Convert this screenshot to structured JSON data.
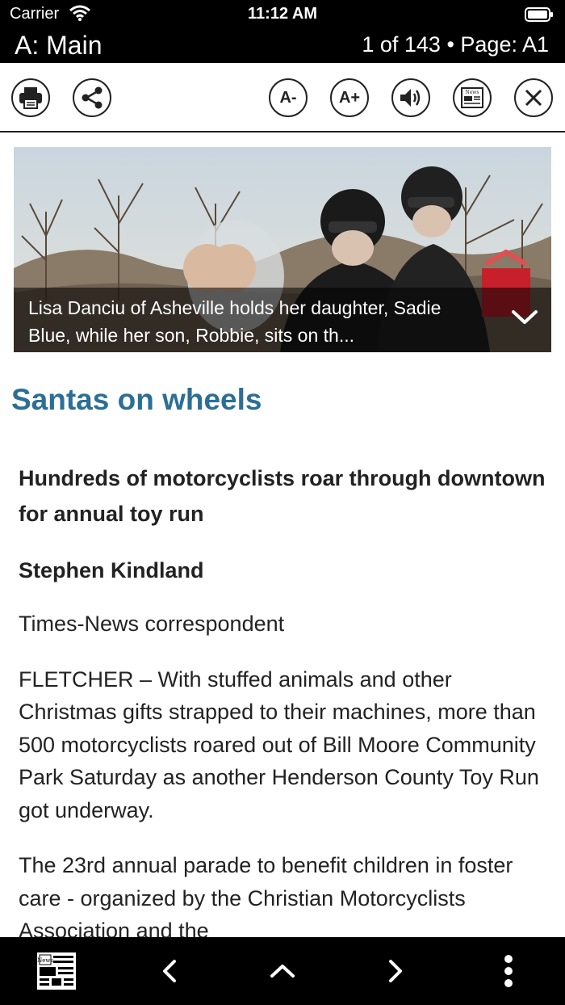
{
  "status_bar": {
    "carrier": "Carrier",
    "time": "11:12 AM"
  },
  "title_bar": {
    "section": "A: Main",
    "page_info": "1 of 143 • Page: A1"
  },
  "toolbar": {
    "print_icon": "printer-icon",
    "share_icon": "share-icon",
    "font_decrease_label": "A-",
    "font_increase_label": "A+",
    "audio_icon": "speaker-icon",
    "newspaper_icon": "newspaper-icon",
    "newspaper_label": "News",
    "close_icon": "close-icon"
  },
  "photo": {
    "caption": "Lisa Danciu of Asheville holds her daughter, Sadie Blue, while her son, Robbie, sits on th...",
    "expand_icon": "chevron-down-icon"
  },
  "article": {
    "headline": "Santas on wheels",
    "subhead": "Hundreds of motorcyclists roar through downtown for annual toy run",
    "author": "Stephen Kindland",
    "author_title": "Times-News correspondent",
    "paragraphs": [
      "FLETCHER – With stuffed animals and other Christmas gifts strapped to their machines, more than 500 motorcyclists roared out of Bill Moore Community Park Saturday as another Henderson County Toy Run got underway.",
      "The 23rd annual parade to benefit children in foster care - organized by the Christian Motorcyclists Association and the"
    ]
  },
  "bottom_bar": {
    "newspaper_label": "News",
    "newspaper_icon": "newspaper-icon",
    "prev_icon": "chevron-left-icon",
    "up_icon": "chevron-up-icon",
    "next_icon": "chevron-right-icon",
    "more_icon": "more-vertical-icon"
  },
  "colors": {
    "headline": "#2c6e96",
    "bars": "#000000",
    "text": "#222222"
  }
}
